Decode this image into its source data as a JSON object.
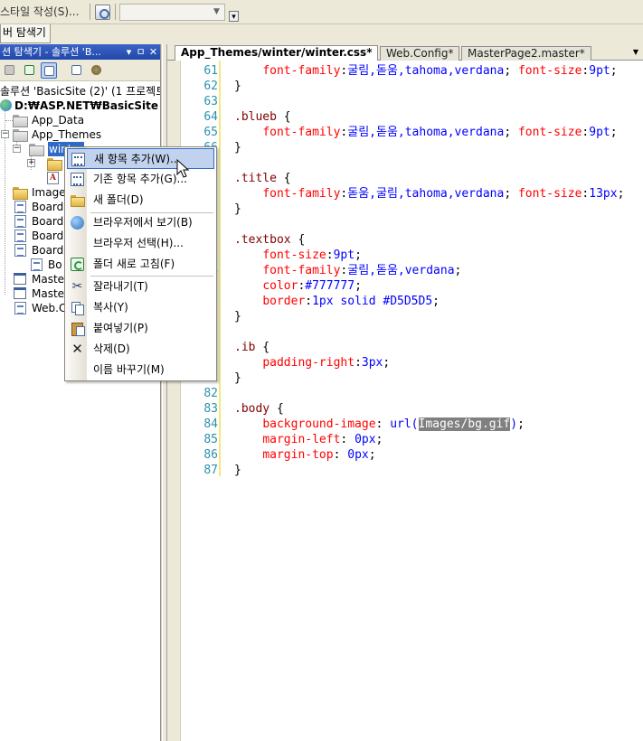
{
  "toolbar": {
    "style_builder_label": "스타일 작성(S)...",
    "combo_value": ""
  },
  "panel_tab_label": "버 탐색기",
  "solution_explorer": {
    "title": "션 탐색기 - 솔루션 'B...",
    "pin_label": "ㅁ",
    "close_label": "✕",
    "dropdown_label": "▾",
    "tree": {
      "solution": "솔루션 'BasicSite (2)' (1 프로젝트",
      "project": "D:₩ASP.NET₩BasicSite",
      "app_data": "App_Data",
      "app_themes": "App_Themes",
      "winter": "winter",
      "images": "Image",
      "board1": "Board.",
      "board2": "Board.",
      "board3": "Board.",
      "board4": "Board.",
      "bo": "Bo",
      "master1": "Maste",
      "master2": "Maste",
      "webconfig": "Web.C"
    }
  },
  "doc_tabs": [
    {
      "label": "App_Themes/winter/winter.css*"
    },
    {
      "label": "Web.Config*"
    },
    {
      "label": "MasterPage2.master*"
    }
  ],
  "editor": {
    "lines": [
      {
        "num": "61",
        "tokens": [
          {
            "t": "    "
          },
          {
            "t": "font-family",
            "c": "prop"
          },
          {
            "t": ":"
          },
          {
            "t": "굴림,돋움,tahoma,verdana",
            "c": "val"
          },
          {
            "t": "; "
          },
          {
            "t": "font-size",
            "c": "prop"
          },
          {
            "t": ":"
          },
          {
            "t": "9pt",
            "c": "val"
          },
          {
            "t": ";"
          }
        ]
      },
      {
        "num": "62",
        "tokens": [
          {
            "t": "}"
          }
        ]
      },
      {
        "num": "63",
        "tokens": []
      },
      {
        "num": "64",
        "tokens": [
          {
            "t": ".blueb",
            "c": "sel"
          },
          {
            "t": " {"
          }
        ]
      },
      {
        "num": "65",
        "tokens": [
          {
            "t": "    "
          },
          {
            "t": "font-family",
            "c": "prop"
          },
          {
            "t": ":"
          },
          {
            "t": "굴림,돋움,tahoma,verdana",
            "c": "val"
          },
          {
            "t": "; "
          },
          {
            "t": "font-size",
            "c": "prop"
          },
          {
            "t": ":"
          },
          {
            "t": "9pt",
            "c": "val"
          },
          {
            "t": ";"
          }
        ]
      },
      {
        "num": "66",
        "tokens": [
          {
            "t": "}"
          }
        ]
      },
      {
        "num": "67",
        "tokens": []
      },
      {
        "num": "68",
        "tokens": [
          {
            "t": ".title",
            "c": "sel"
          },
          {
            "t": " {"
          }
        ]
      },
      {
        "num": "69",
        "tokens": [
          {
            "t": "    "
          },
          {
            "t": "font-family",
            "c": "prop"
          },
          {
            "t": ":"
          },
          {
            "t": "돋움,굴림,tahoma,verdana",
            "c": "val"
          },
          {
            "t": "; "
          },
          {
            "t": "font-size",
            "c": "prop"
          },
          {
            "t": ":"
          },
          {
            "t": "13px",
            "c": "val"
          },
          {
            "t": ";"
          }
        ]
      },
      {
        "num": "70",
        "tokens": [
          {
            "t": "}"
          }
        ]
      },
      {
        "num": "71",
        "tokens": []
      },
      {
        "num": "72",
        "tokens": [
          {
            "t": ".textbox",
            "c": "sel"
          },
          {
            "t": " {"
          }
        ]
      },
      {
        "num": "73",
        "tokens": [
          {
            "t": "    "
          },
          {
            "t": "font-size",
            "c": "prop"
          },
          {
            "t": ":"
          },
          {
            "t": "9pt",
            "c": "val"
          },
          {
            "t": ";"
          }
        ]
      },
      {
        "num": "74",
        "tokens": [
          {
            "t": "    "
          },
          {
            "t": "font-family",
            "c": "prop"
          },
          {
            "t": ":"
          },
          {
            "t": "굴림,돋움,verdana",
            "c": "val"
          },
          {
            "t": ";"
          }
        ]
      },
      {
        "num": "75",
        "tokens": [
          {
            "t": "    "
          },
          {
            "t": "color",
            "c": "prop"
          },
          {
            "t": ":"
          },
          {
            "t": "#777777",
            "c": "val"
          },
          {
            "t": ";"
          }
        ]
      },
      {
        "num": "76",
        "tokens": [
          {
            "t": "    "
          },
          {
            "t": "border",
            "c": "prop"
          },
          {
            "t": ":"
          },
          {
            "t": "1px solid #D5D5D5",
            "c": "val"
          },
          {
            "t": ";"
          }
        ]
      },
      {
        "num": "77",
        "tokens": [
          {
            "t": "}"
          }
        ]
      },
      {
        "num": "78",
        "tokens": []
      },
      {
        "num": "79",
        "tokens": [
          {
            "t": ".ib",
            "c": "sel"
          },
          {
            "t": " {"
          }
        ]
      },
      {
        "num": "80",
        "tokens": [
          {
            "t": "    "
          },
          {
            "t": "padding-right",
            "c": "prop"
          },
          {
            "t": ":"
          },
          {
            "t": "3px",
            "c": "val"
          },
          {
            "t": ";"
          }
        ]
      },
      {
        "num": "81",
        "tokens": [
          {
            "t": "}"
          }
        ]
      },
      {
        "num": "82",
        "tokens": []
      },
      {
        "num": "83",
        "tokens": [
          {
            "t": ".body",
            "c": "sel"
          },
          {
            "t": " {"
          }
        ]
      },
      {
        "num": "84",
        "tokens": [
          {
            "t": "    "
          },
          {
            "t": "background-image",
            "c": "prop"
          },
          {
            "t": ": "
          },
          {
            "t": "url(",
            "c": "val"
          },
          {
            "t": "Images/bg.gif",
            "c": "hl"
          },
          {
            "t": ")",
            "c": "val"
          },
          {
            "t": ";"
          }
        ]
      },
      {
        "num": "85",
        "tokens": [
          {
            "t": "    "
          },
          {
            "t": "margin-left",
            "c": "prop"
          },
          {
            "t": ": "
          },
          {
            "t": "0px",
            "c": "val"
          },
          {
            "t": ";"
          }
        ]
      },
      {
        "num": "86",
        "tokens": [
          {
            "t": "    "
          },
          {
            "t": "margin-top",
            "c": "prop"
          },
          {
            "t": ": "
          },
          {
            "t": "0px",
            "c": "val"
          },
          {
            "t": ";"
          }
        ]
      },
      {
        "num": "87",
        "tokens": [
          {
            "t": "}"
          }
        ]
      }
    ]
  },
  "context_menu": {
    "items": [
      {
        "label": "새 항목 추가(W)...",
        "icon": "add-new-item-icon"
      },
      {
        "label": "기존 항목 추가(G)...",
        "icon": "add-existing-item-icon"
      },
      {
        "label": "새 폴더(D)",
        "icon": "new-folder-icon"
      },
      {
        "label": "브라우저에서 보기(B)",
        "icon": "view-in-browser-icon"
      },
      {
        "label": "브라우저 선택(H)...",
        "icon": ""
      },
      {
        "label": "폴더 새로 고침(F)",
        "icon": "refresh-folder-icon"
      },
      {
        "label": "잘라내기(T)",
        "icon": "cut-icon"
      },
      {
        "label": "복사(Y)",
        "icon": "copy-icon"
      },
      {
        "label": "붙여넣기(P)",
        "icon": "paste-icon"
      },
      {
        "label": "삭제(D)",
        "icon": "delete-icon"
      },
      {
        "label": "이름 바꾸기(M)",
        "icon": ""
      }
    ]
  },
  "colors": {
    "selector": "#800000",
    "property": "#ff0000",
    "value": "#0000ff",
    "line_number": "#2b91af",
    "menu_highlight": "#c1d2ee",
    "title_bar": "#2148a8"
  }
}
